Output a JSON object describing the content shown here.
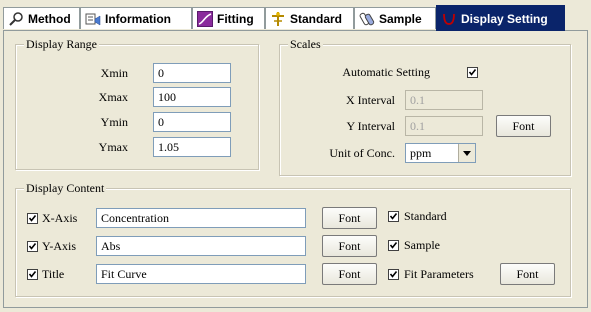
{
  "tabs": [
    {
      "label": "Method",
      "icon": "magnifier-icon"
    },
    {
      "label": "Information",
      "icon": "information-icon"
    },
    {
      "label": "Fitting",
      "icon": "fitting-curve-icon"
    },
    {
      "label": "Standard",
      "icon": "standard-icon"
    },
    {
      "label": "Sample",
      "icon": "sample-icon"
    },
    {
      "label": "Display Setting",
      "icon": "display-setting-icon",
      "active": true
    }
  ],
  "display_range": {
    "title": "Display Range",
    "xmin_label": "Xmin",
    "xmin_value": "0",
    "xmax_label": "Xmax",
    "xmax_value": "100",
    "ymin_label": "Ymin",
    "ymin_value": "0",
    "ymax_label": "Ymax",
    "ymax_value": "1.05"
  },
  "scales": {
    "title": "Scales",
    "auto_label": "Automatic Setting",
    "auto_checked": true,
    "x_interval_label": "X Interval",
    "x_interval_value": "0.1",
    "y_interval_label": "Y Interval",
    "y_interval_value": "0.1",
    "font_button": "Font",
    "unit_label": "Unit of Conc.",
    "unit_value": "ppm"
  },
  "display_content": {
    "title": "Display Content",
    "x_axis_label": "X-Axis",
    "x_axis_checked": true,
    "x_axis_value": "Concentration",
    "y_axis_label": "Y-Axis",
    "y_axis_checked": true,
    "y_axis_value": "Abs",
    "title_label": "Title",
    "title_checked": true,
    "title_value": "Fit Curve",
    "font_button": "Font",
    "standard_label": "Standard",
    "standard_checked": true,
    "sample_label": "Sample",
    "sample_checked": true,
    "fit_params_label": "Fit Parameters",
    "fit_params_checked": true
  },
  "colors": {
    "active_tab": "#0a246a",
    "panel_bg": "#ece9d8"
  }
}
